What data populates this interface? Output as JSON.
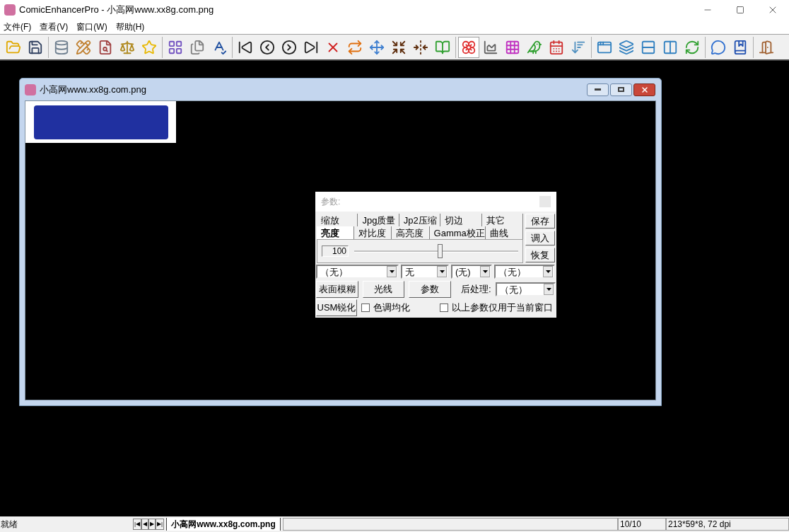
{
  "window": {
    "title": "ComicEnhancerPro - 小高网www.xx8g.com.png"
  },
  "menu": [
    "文件(F)",
    "查看(V)",
    "窗口(W)",
    "帮助(H)"
  ],
  "toolbar": [
    {
      "buttons": [
        {
          "selected": false
        },
        {
          "selected": false
        }
      ]
    },
    {
      "buttons": [
        {
          "selected": false
        },
        {
          "selected": false
        },
        {
          "selected": false
        },
        {
          "selected": false
        },
        {
          "selected": false
        }
      ]
    },
    {
      "buttons": [
        {
          "selected": false
        },
        {
          "selected": false
        },
        {
          "selected": false
        }
      ]
    },
    {
      "buttons": [
        {
          "selected": false
        },
        {
          "selected": false
        },
        {
          "selected": false
        },
        {
          "selected": false
        },
        {
          "selected": false
        },
        {
          "selected": false
        },
        {
          "selected": false
        },
        {
          "selected": false
        },
        {
          "selected": false
        },
        {
          "selected": false
        }
      ]
    },
    {
      "buttons": [
        {
          "selected": true
        },
        {
          "selected": false
        },
        {
          "selected": false
        },
        {
          "selected": false
        },
        {
          "selected": false
        },
        {
          "selected": false
        }
      ]
    },
    {
      "buttons": [
        {
          "selected": false
        },
        {
          "selected": false
        },
        {
          "selected": false
        },
        {
          "selected": false
        },
        {
          "selected": false
        }
      ]
    },
    {
      "buttons": [
        {
          "selected": false
        },
        {
          "selected": false
        }
      ]
    },
    {
      "buttons": [
        {
          "selected": false
        }
      ]
    }
  ],
  "child_window": {
    "title": "小高网www.xx8g.com.png"
  },
  "params_panel": {
    "title": "参数:",
    "tab_rows": [
      [
        {
          "label": "缩放",
          "selected": false
        },
        {
          "label": "Jpg质量",
          "selected": false
        },
        {
          "label": "Jp2压缩",
          "selected": false
        },
        {
          "label": "切边",
          "selected": false
        },
        {
          "label": "其它",
          "selected": false
        }
      ],
      [
        {
          "label": "亮度",
          "selected": true
        },
        {
          "label": "对比度",
          "selected": false
        },
        {
          "label": "高亮度",
          "selected": false
        },
        {
          "label": "Gamma校正",
          "selected": false
        },
        {
          "label": "曲线",
          "selected": false
        }
      ]
    ],
    "value": "100",
    "level": 0.52,
    "side_buttons": [
      "保存",
      "调入",
      "恢复"
    ],
    "dropdowns": [
      "（无）",
      "无",
      "(无)",
      "（无）"
    ],
    "buttons": [
      "表面模糊",
      "光线",
      "参数"
    ],
    "post_label": "后处理:",
    "post_dropdown": "（无）",
    "usm_button": "USM锐化",
    "checkboxes": [
      {
        "label": "色调均化",
        "checked": false
      },
      {
        "label": "以上参数仅用于当前窗口",
        "checked": false
      }
    ]
  },
  "status_bar": {
    "message": "就绪",
    "nav": [
      "|◀",
      "◀",
      "▶",
      "▶|"
    ],
    "tab": "小高网www.xx8g.com.png",
    "count": "10/10",
    "info": "213*59*8, 72 dpi"
  }
}
